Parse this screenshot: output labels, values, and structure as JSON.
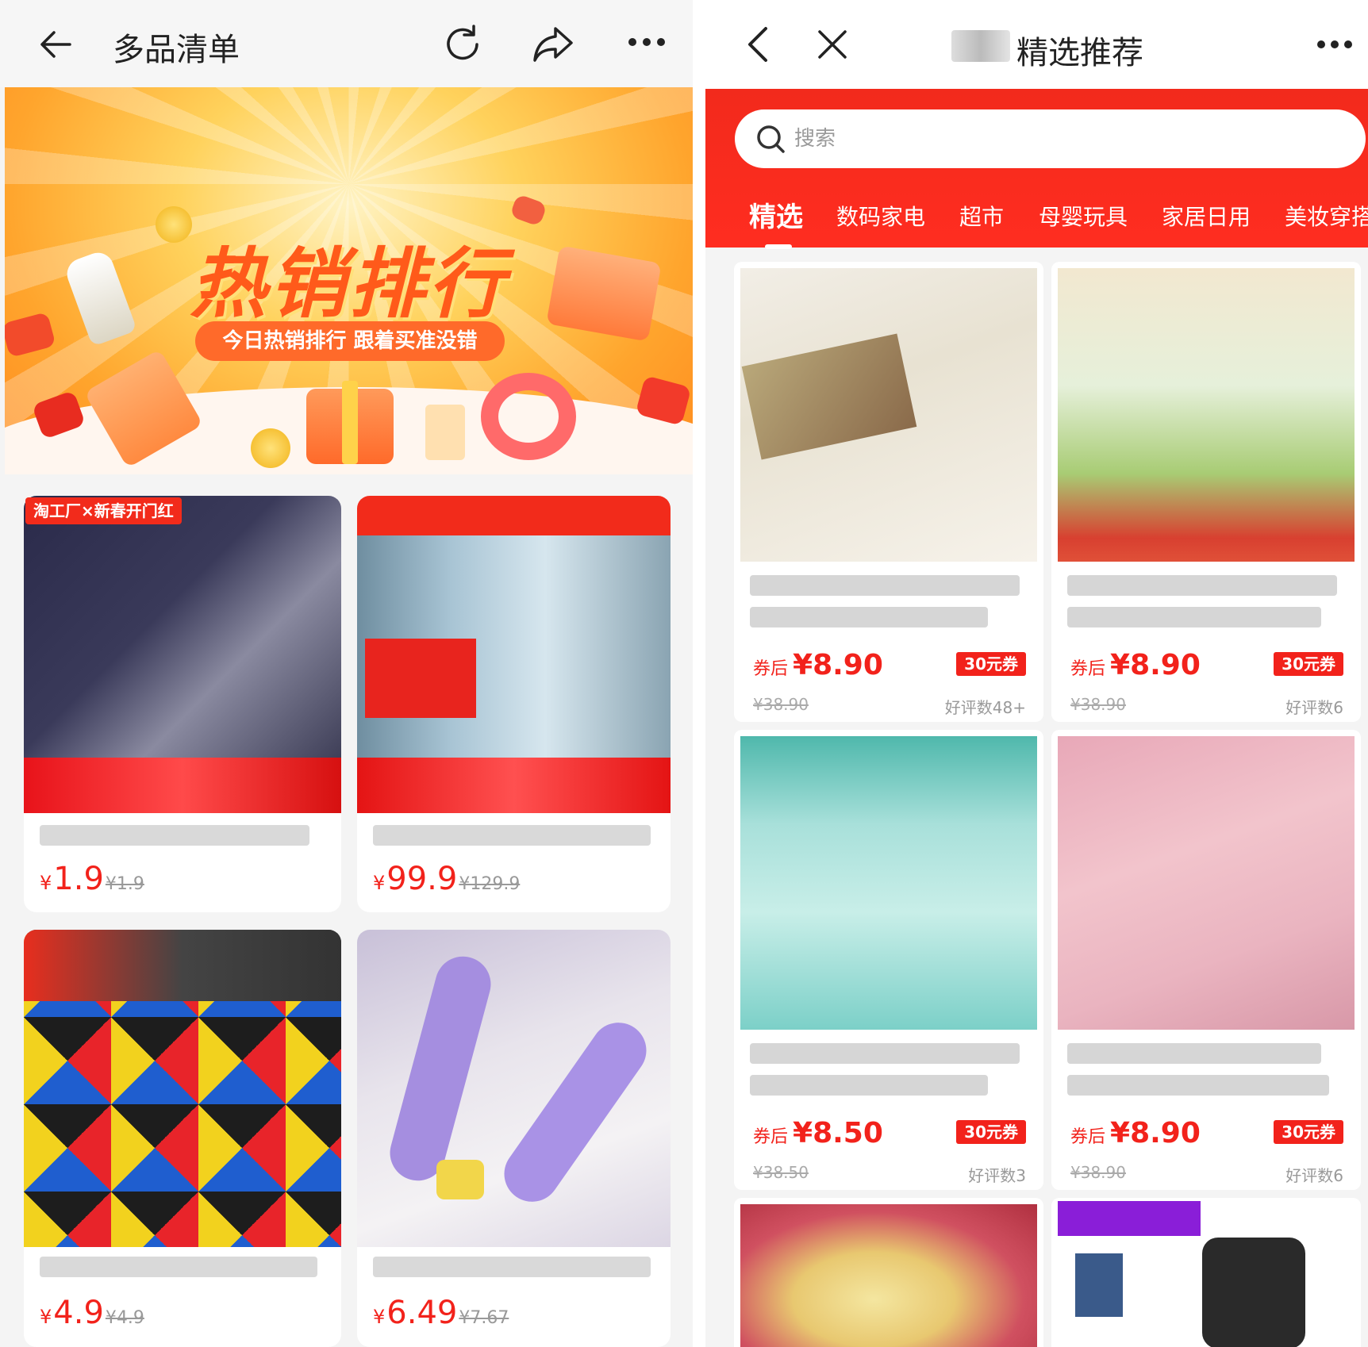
{
  "left": {
    "title": "多品清单",
    "banner": {
      "title": "热销排行",
      "subtitle": "今日热销排行 跟着买准没错"
    },
    "products": [
      {
        "tag": "淘工厂×新春开门红",
        "price": "1.9",
        "original": "¥1.9"
      },
      {
        "tag": "",
        "price": "99.9",
        "original": "¥129.9"
      },
      {
        "tag": "",
        "price": "4.9",
        "original": "¥4.9"
      },
      {
        "tag": "",
        "price": "6.49",
        "original": "¥7.67"
      }
    ]
  },
  "right": {
    "title": "精选推荐",
    "search": {
      "placeholder": "搜索"
    },
    "tabs": [
      "精选",
      "数码家电",
      "超市",
      "母婴玩具",
      "家居日用",
      "美妆穿搭"
    ],
    "active_tab": "精选",
    "products": [
      {
        "after_label": "券后",
        "price": "¥8.90",
        "coupon": "30元券",
        "original": "¥38.90",
        "reviews": "好评数48+"
      },
      {
        "after_label": "券后",
        "price": "¥8.90",
        "coupon": "30元券",
        "original": "¥38.90",
        "reviews": "好评数6"
      },
      {
        "after_label": "券后",
        "price": "¥8.50",
        "coupon": "30元券",
        "original": "¥38.50",
        "reviews": "好评数3"
      },
      {
        "after_label": "券后",
        "price": "¥8.90",
        "coupon": "30元券",
        "original": "¥38.90",
        "reviews": "好评数6"
      }
    ]
  },
  "icons": {
    "back": "arrow-left-icon",
    "refresh": "refresh-icon",
    "share": "share-icon",
    "more": "more-icon",
    "chevron": "chevron-left-icon",
    "close": "close-icon",
    "search": "search-icon"
  },
  "colors": {
    "accent_red": "#f2221b",
    "banner_orange": "#ff8a1e",
    "header_red": "#f22a1c"
  }
}
